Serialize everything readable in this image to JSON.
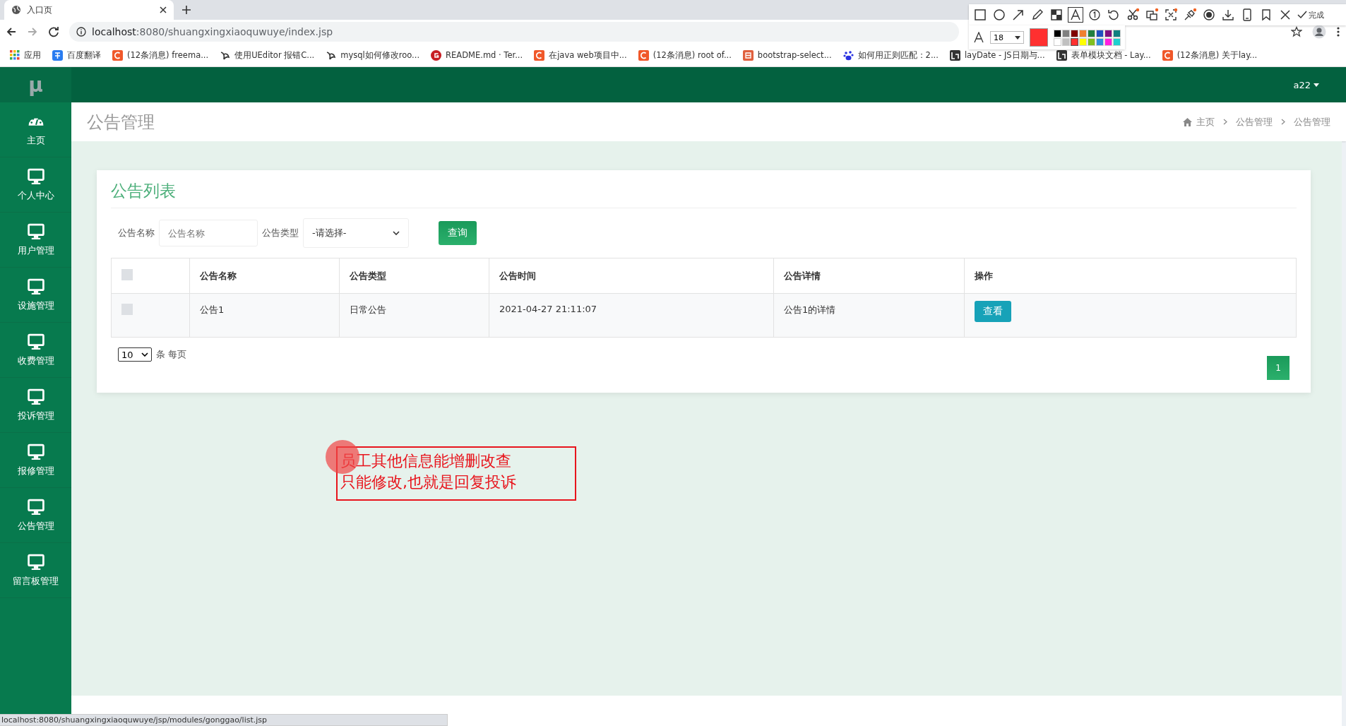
{
  "browser": {
    "tabs": [
      {
        "title": "入口页",
        "selected": true
      }
    ],
    "url_host": "localhost",
    "url_path": ":8080/shuangxingxiaoquwuye/index.jsp",
    "bookmarks": [
      {
        "kind": "apps",
        "label": "应用"
      },
      {
        "kind": "translate",
        "label": "百度翻译"
      },
      {
        "kind": "csdn",
        "label": "(12条消息) freema..."
      },
      {
        "kind": "yuque",
        "label": "使用UEditor 报错C..."
      },
      {
        "kind": "yuque",
        "label": "mysql如何修改roo..."
      },
      {
        "kind": "gitee",
        "label": "README.md · Ter..."
      },
      {
        "kind": "csdn",
        "label": "在java web项目中..."
      },
      {
        "kind": "csdn",
        "label": "(12条消息) root of..."
      },
      {
        "kind": "jian",
        "label": "bootstrap-select..."
      },
      {
        "kind": "baidu",
        "label": "如何用正则匹配：2..."
      },
      {
        "kind": "layui",
        "label": "layDate - JS日期与..."
      },
      {
        "kind": "layui",
        "label": "表单模块文档 - Lay..."
      },
      {
        "kind": "csdn",
        "label": "(12条消息) 关于lay..."
      }
    ]
  },
  "capture_toolbar": {
    "tools": [
      {
        "kind": "rect",
        "selected": false
      },
      {
        "kind": "circle",
        "selected": false
      },
      {
        "kind": "arrow",
        "selected": false
      },
      {
        "kind": "pencil",
        "selected": false
      },
      {
        "kind": "mosaic",
        "selected": false
      },
      {
        "kind": "text",
        "selected": true
      },
      {
        "kind": "number",
        "selected": false
      },
      {
        "kind": "undo",
        "selected": false
      },
      {
        "kind": "scissors",
        "selected": false
      },
      {
        "kind": "ocr",
        "selected": false
      },
      {
        "kind": "scan",
        "selected": false
      },
      {
        "kind": "pin",
        "selected": false
      },
      {
        "kind": "record",
        "selected": false
      },
      {
        "kind": "download",
        "selected": false
      },
      {
        "kind": "phone",
        "selected": false
      },
      {
        "kind": "bookmark",
        "selected": false
      },
      {
        "kind": "close",
        "selected": false
      }
    ],
    "done_label": "完成",
    "font_size": "18",
    "swatches": [
      {
        "color": "#000000",
        "selected": false
      },
      {
        "color": "#808080",
        "selected": false
      },
      {
        "color": "#800000",
        "selected": false
      },
      {
        "color": "#f08030",
        "selected": false
      },
      {
        "color": "#208040",
        "selected": false
      },
      {
        "color": "#2050c0",
        "selected": false
      },
      {
        "color": "#801080",
        "selected": false
      },
      {
        "color": "#108080",
        "selected": false
      },
      {
        "color": "#ffffff",
        "selected": false
      },
      {
        "color": "#c0c0c0",
        "selected": false
      },
      {
        "color": "#ff3030",
        "selected": true
      },
      {
        "color": "#ffff00",
        "selected": false
      },
      {
        "color": "#80c020",
        "selected": false
      },
      {
        "color": "#3090e0",
        "selected": false
      },
      {
        "color": "#ff20e0",
        "selected": false
      },
      {
        "color": "#20d0d0",
        "selected": false
      }
    ]
  },
  "app": {
    "logo": "μ",
    "user": "a22",
    "sidebar": {
      "items": [
        {
          "kind": "dashboard",
          "label": "主页"
        },
        {
          "kind": "monitor",
          "label": "个人中心"
        },
        {
          "kind": "monitor",
          "label": "用户管理"
        },
        {
          "kind": "monitor",
          "label": "设施管理"
        },
        {
          "kind": "monitor",
          "label": "收费管理"
        },
        {
          "kind": "monitor",
          "label": "投诉管理"
        },
        {
          "kind": "monitor",
          "label": "报修管理"
        },
        {
          "kind": "monitor",
          "label": "公告管理"
        },
        {
          "kind": "monitor",
          "label": "留言板管理"
        }
      ]
    },
    "page_title": "公告管理",
    "breadcrumbs": [
      "主页",
      "公告管理",
      "公告管理"
    ],
    "card": {
      "title": "公告列表",
      "search": {
        "name_label": "公告名称",
        "name_placeholder": "公告名称",
        "type_label": "公告类型",
        "type_value": "-请选择-",
        "button": "查询"
      },
      "table": {
        "columns": [
          "公告名称",
          "公告类型",
          "公告时间",
          "公告详情",
          "操作"
        ],
        "rows": [
          {
            "checked": false,
            "cells": [
              "公告1",
              "日常公告",
              "2021-04-27 21:11:07",
              "公告1的详情"
            ],
            "action": "查看"
          }
        ],
        "header_checked": false
      },
      "page_size": "10",
      "page_size_label": "条 每页",
      "pages": [
        {
          "label": "1",
          "selected": true
        }
      ]
    },
    "note": [
      "员工其他信息能增删改查",
      "只能修改,也就是回复投诉"
    ]
  },
  "status_bar": "localhost:8080/shuangxingxiaoquwuye/jsp/modules/gonggao/list.jsp"
}
